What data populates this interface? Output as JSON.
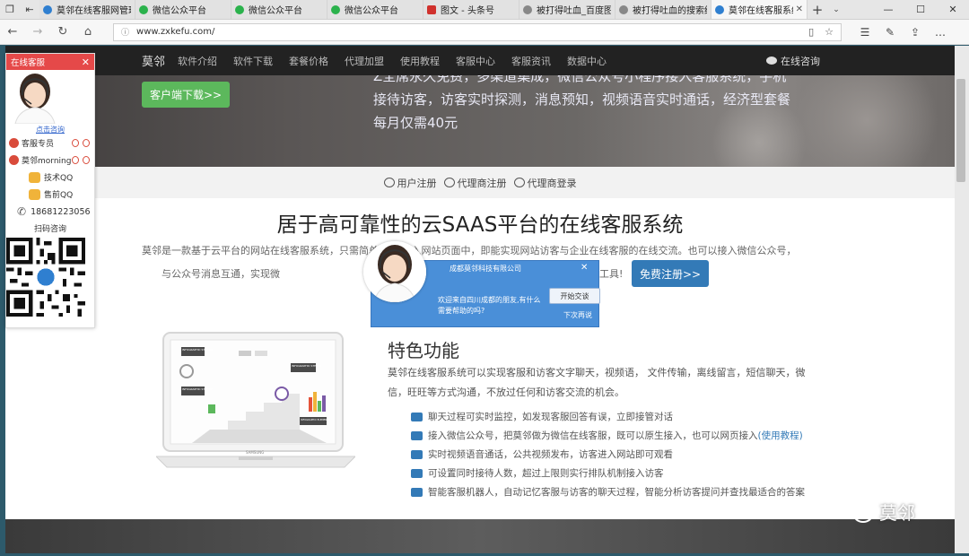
{
  "browser": {
    "tabs": [
      {
        "title": "莫邻在线客服网管理!",
        "color": "#2f7fd0",
        "active": false
      },
      {
        "title": "微信公众平台",
        "color": "#2bb24c",
        "active": false
      },
      {
        "title": "微信公众平台",
        "color": "#2bb24c",
        "active": false
      },
      {
        "title": "微信公众平台",
        "color": "#2bb24c",
        "active": false
      },
      {
        "title": "图文 - 头条号",
        "color": "#d0312d",
        "active": false
      },
      {
        "title": "被打得吐血_百度图片",
        "color": "#888888",
        "active": false
      },
      {
        "title": "被打得吐血的搜索结!",
        "color": "#888888",
        "active": false
      },
      {
        "title": "莫邻在线客服系统",
        "color": "#2f7fd0",
        "active": true
      }
    ],
    "tab_close": "✕",
    "new_tab": "+",
    "url": "www.zxkefu.com/"
  },
  "site": {
    "logo": "莫邻",
    "nav_links": [
      "软件介绍",
      "软件下载",
      "套餐价格",
      "代理加盟",
      "使用教程",
      "客服中心",
      "客服资讯",
      "数据中心"
    ],
    "consult": "在线咨询",
    "hero_button": "客户端下载>>",
    "hero_line1": "Z全席永久免费，多渠道集成，微信公众号小程序接入客服系统，手机",
    "hero_line2": "接待访客，访客实时探测，消息预知，视频语音实时通话，经济型套餐",
    "hero_line3": "每月仅需40元",
    "register": {
      "user": "用户注册",
      "agent": "代理商注册",
      "agent_login": "代理商登录"
    },
    "main_title": "居于高可靠性的云SAAS平台的在线客服系统",
    "intro_line1": "莫邻是一款基于云平台的网站在线客服系统，只需简单             代码嵌入网站页面中，即能实现网站访客与企业在线客服的在线交流。也可以接入微信公众号，",
    "intro_line2": "与公众号消息互通，实现微",
    "intro_line2_end": "工具!",
    "free_button": "免费注册>>",
    "feature_title": "特色功能",
    "feature_desc": "莫邻在线客服系统可以实现客服和访客文字聊天，视频语， 文件传输，离线留言，短信聊天，微信，旺旺等方式沟通，不放过任何和访客交流的机会。",
    "features": [
      {
        "text": "聊天过程可实时监控，如发现客服回答有误，立即接管对话",
        "link": ""
      },
      {
        "text": "接入微信公众号，把莫邻做为微信在线客服，既可以原生接入，也可以网页接入",
        "link": "(使用教程)"
      },
      {
        "text": "实时视频语音通话，公共视频发布，访客进入网站即可观看",
        "link": ""
      },
      {
        "text": "可设置同时接待人数，超过上限则实行排队机制接入访客",
        "link": ""
      },
      {
        "text": "智能客服机器人，自动记忆客服与访客的聊天过程，智能分析访客提问并查找最适合的答案",
        "link": ""
      }
    ],
    "laptop_labels": {
      "step03": "INFOGRAPHIC STEP 03",
      "step01": "INFOGRAPHIC STEP 01",
      "step02": "INFOGRAPHIC STEP 02",
      "elements": "INFOGRAPHIC ELEMENTS",
      "brand": "SAMSUNG"
    }
  },
  "cs_widget": {
    "title": "在线客服",
    "close": "✕",
    "click_consult": "点击咨询",
    "agents": [
      "客服专员",
      "莫邻morning"
    ],
    "qq": [
      "技术QQ",
      "售前QQ"
    ],
    "phone": "18681223056",
    "scan": "扫码咨询"
  },
  "invite": {
    "company": "成都莫邻科技有限公司",
    "close": "✕",
    "message": "欢迎来自四川成都的朋友,有什么需要帮助的吗?",
    "start": "开始交谈",
    "later": "下次再说"
  },
  "watermark": "莫邻"
}
